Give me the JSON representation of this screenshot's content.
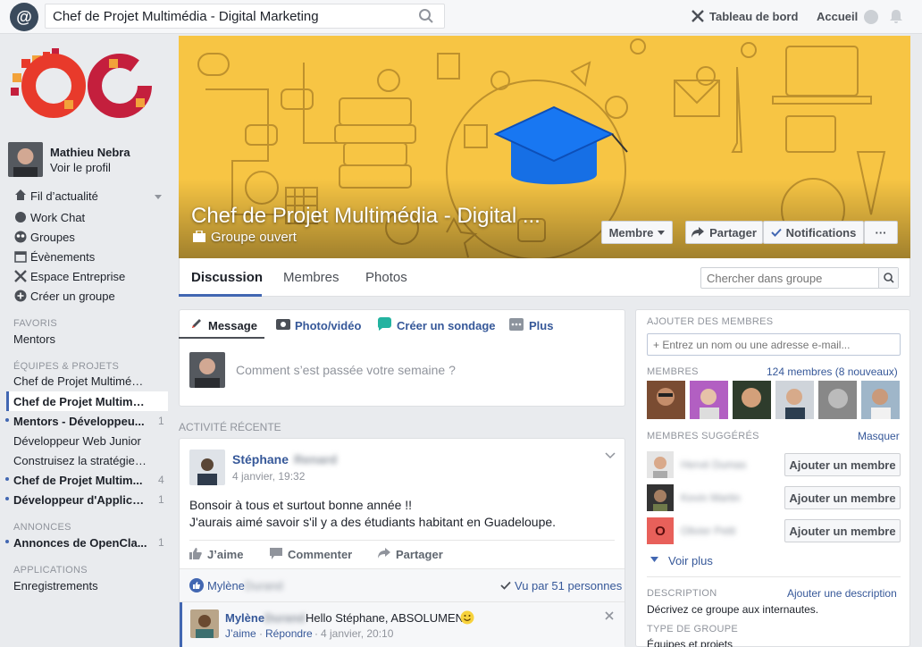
{
  "topbar": {
    "search_value": "Chef de Projet Multimédia - Digital Marketing",
    "dashboard_label": "Tableau de bord",
    "home_label": "Accueil"
  },
  "sidebar": {
    "user_name": "Mathieu Nebra",
    "view_profile": "Voir le profil",
    "nav": [
      "Fil d’actualité",
      "Work Chat",
      "Groupes",
      "Évènements",
      "Espace Entreprise",
      "Créer un groupe"
    ],
    "favorites_header": "FAVORIS",
    "favorites": [
      "Mentors"
    ],
    "teams_header": "ÉQUIPES & PROJETS",
    "teams": [
      {
        "label": "Chef de Projet Multiméd...",
        "count": "",
        "bold": false,
        "dot": false
      },
      {
        "label": "Chef de Projet Multiméd...",
        "count": "",
        "bold": true,
        "dot": false
      },
      {
        "label": "Mentors - Développeu...",
        "count": "1",
        "bold": true,
        "dot": true
      },
      {
        "label": "Développeur Web Junior",
        "count": "",
        "bold": false,
        "dot": false
      },
      {
        "label": "Construisez la stratégie g...",
        "count": "",
        "bold": false,
        "dot": false
      },
      {
        "label": "Chef de Projet Multim...",
        "count": "4",
        "bold": true,
        "dot": true
      },
      {
        "label": "Développeur d'Applica...",
        "count": "1",
        "bold": true,
        "dot": true
      }
    ],
    "announcements_header": "ANNONCES",
    "announcements": [
      {
        "label": "Annonces de OpenCla...",
        "count": "1"
      }
    ],
    "apps_header": "APPLICATIONS",
    "apps": [
      "Enregistrements"
    ]
  },
  "cover": {
    "title": "Chef de Projet Multimédia - Digital ...",
    "subtitle": "Groupe ouvert",
    "member_btn": "Membre",
    "share_btn": "Partager",
    "notif_btn": "Notifications",
    "more_btn": "···"
  },
  "tabs": [
    "Discussion",
    "Membres",
    "Photos"
  ],
  "group_search_placeholder": "Chercher dans groupe",
  "composer": {
    "message": "Message",
    "photo": "Photo/vidéo",
    "poll": "Créer un sondage",
    "more": "Plus",
    "prompt": "Comment s’est passée votre semaine ?"
  },
  "recent_activity": "ACTIVITÉ RÉCENTE",
  "post": {
    "author": "Stéphane",
    "author_last": "Renard",
    "date": "4 janvier, 19:32",
    "line1": "Bonsoir à tous et surtout bonne année !!",
    "line2": "J'aurais aimé savoir s'il y a des étudiants habitant en Guadeloupe.",
    "like": "J’aime",
    "comment": "Commenter",
    "share": "Partager",
    "liker": "Mylène",
    "liker_last": "Durand",
    "seen": "Vu par 51 personnes"
  },
  "comment": {
    "author": "Mylène",
    "author_last": "Durand",
    "text": "Hello Stéphane, ABSOLUMENT",
    "like": "J’aime",
    "reply": "Répondre",
    "date": "4 janvier, 20:10"
  },
  "right": {
    "add_members_header": "AJOUTER DES MEMBRES",
    "add_placeholder": "+ Entrez un nom ou une adresse e-mail...",
    "members_header": "MEMBRES",
    "members_count": "124 membres (8 nouveaux)",
    "suggested_header": "MEMBRES SUGGÉRÉS",
    "hide": "Masquer",
    "add_member_btn": "Ajouter un membre",
    "suggested_names": [
      "Hervé Dumas",
      "Kevin Martin",
      "Olivier Petit"
    ],
    "see_more": "Voir plus",
    "description_header": "DESCRIPTION",
    "add_description": "Ajouter une description",
    "description_text": "Décrivez ce groupe aux internautes.",
    "type_header": "TYPE DE GROUPE",
    "type_value": "Équipes et projets"
  },
  "colors": {
    "accent": "#365899",
    "cover_yellow": "#f7c544",
    "cap_blue": "#1877f2",
    "oc_red": "#e83a2b"
  }
}
